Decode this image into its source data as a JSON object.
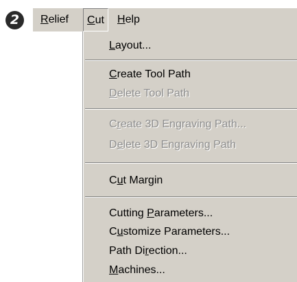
{
  "step_badge": "2",
  "menubar": {
    "items": [
      {
        "pre": "",
        "u": "R",
        "post": "elief"
      },
      {
        "pre": "",
        "u": "C",
        "post": "ut"
      },
      {
        "pre": "",
        "u": "H",
        "post": "elp"
      }
    ]
  },
  "menu": {
    "items": [
      {
        "pre": "",
        "u": "L",
        "post": "ayout...",
        "enabled": true
      },
      {
        "pre": "",
        "u": "C",
        "post": "reate Tool Path",
        "enabled": true
      },
      {
        "pre": "",
        "u": "D",
        "post": "elete Tool Path",
        "enabled": false
      },
      {
        "pre": "C",
        "u": "r",
        "post": "eate 3D Engraving Path...",
        "enabled": false
      },
      {
        "pre": "D",
        "u": "e",
        "post": "lete 3D Engraving Path",
        "enabled": false
      },
      {
        "pre": "C",
        "u": "u",
        "post": "t Margin",
        "enabled": true
      },
      {
        "pre": "Cutting ",
        "u": "P",
        "post": "arameters...",
        "enabled": true
      },
      {
        "pre": "C",
        "u": "u",
        "post": "stomize Parameters...",
        "enabled": true
      },
      {
        "pre": "Path Di",
        "u": "r",
        "post": "ection...",
        "enabled": true
      },
      {
        "pre": "",
        "u": "M",
        "post": "achines...",
        "enabled": true
      }
    ]
  }
}
